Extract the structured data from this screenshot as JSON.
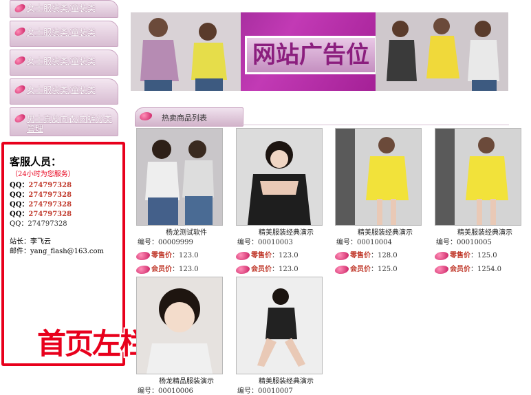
{
  "sidebar": {
    "categories": [
      "女士服装类/童装类",
      "女士服装类/童装类",
      "女士服装类/童装类",
      "女士服装类/童装类",
      "男士真皮内衣/内裤分类管理"
    ]
  },
  "service": {
    "title": "客服人员：",
    "subtitle": "（24小时为您服务）",
    "qq_label": "QQ：",
    "qq": [
      "274797328",
      "274797328",
      "274797328",
      "274797328",
      "274797328"
    ],
    "webmaster": "站长：李飞云",
    "email": "邮件：yang_flash@163.com"
  },
  "overlay_caption": "首页左栏编辑",
  "banner": {
    "text": "网站广告位"
  },
  "section": {
    "title": "热卖商品列表"
  },
  "labels": {
    "retail": "零售价",
    "member": "会员价"
  },
  "products": [
    {
      "name": "杨龙测试软件",
      "sku": "编号：00009999",
      "retail": "：123.0",
      "member": "：123.0"
    },
    {
      "name": "精美服装经典演示",
      "sku": "编号：00010003",
      "retail": "：123.0",
      "member": "：123.0"
    },
    {
      "name": "精美服装经典演示",
      "sku": "编号：00010004",
      "retail": "：128.0",
      "member": "：125.0"
    },
    {
      "name": "精美服装经典演示",
      "sku": "编号：00010005",
      "retail": "：125.0",
      "member": "：1254.0"
    },
    {
      "name": "杨龙精品服装演示",
      "sku": "编号：00010006"
    },
    {
      "name": "精美服装经典演示",
      "sku": "编号：00010007"
    }
  ],
  "colors": {
    "accent": "#e8001c",
    "brand": "#b0279f"
  }
}
